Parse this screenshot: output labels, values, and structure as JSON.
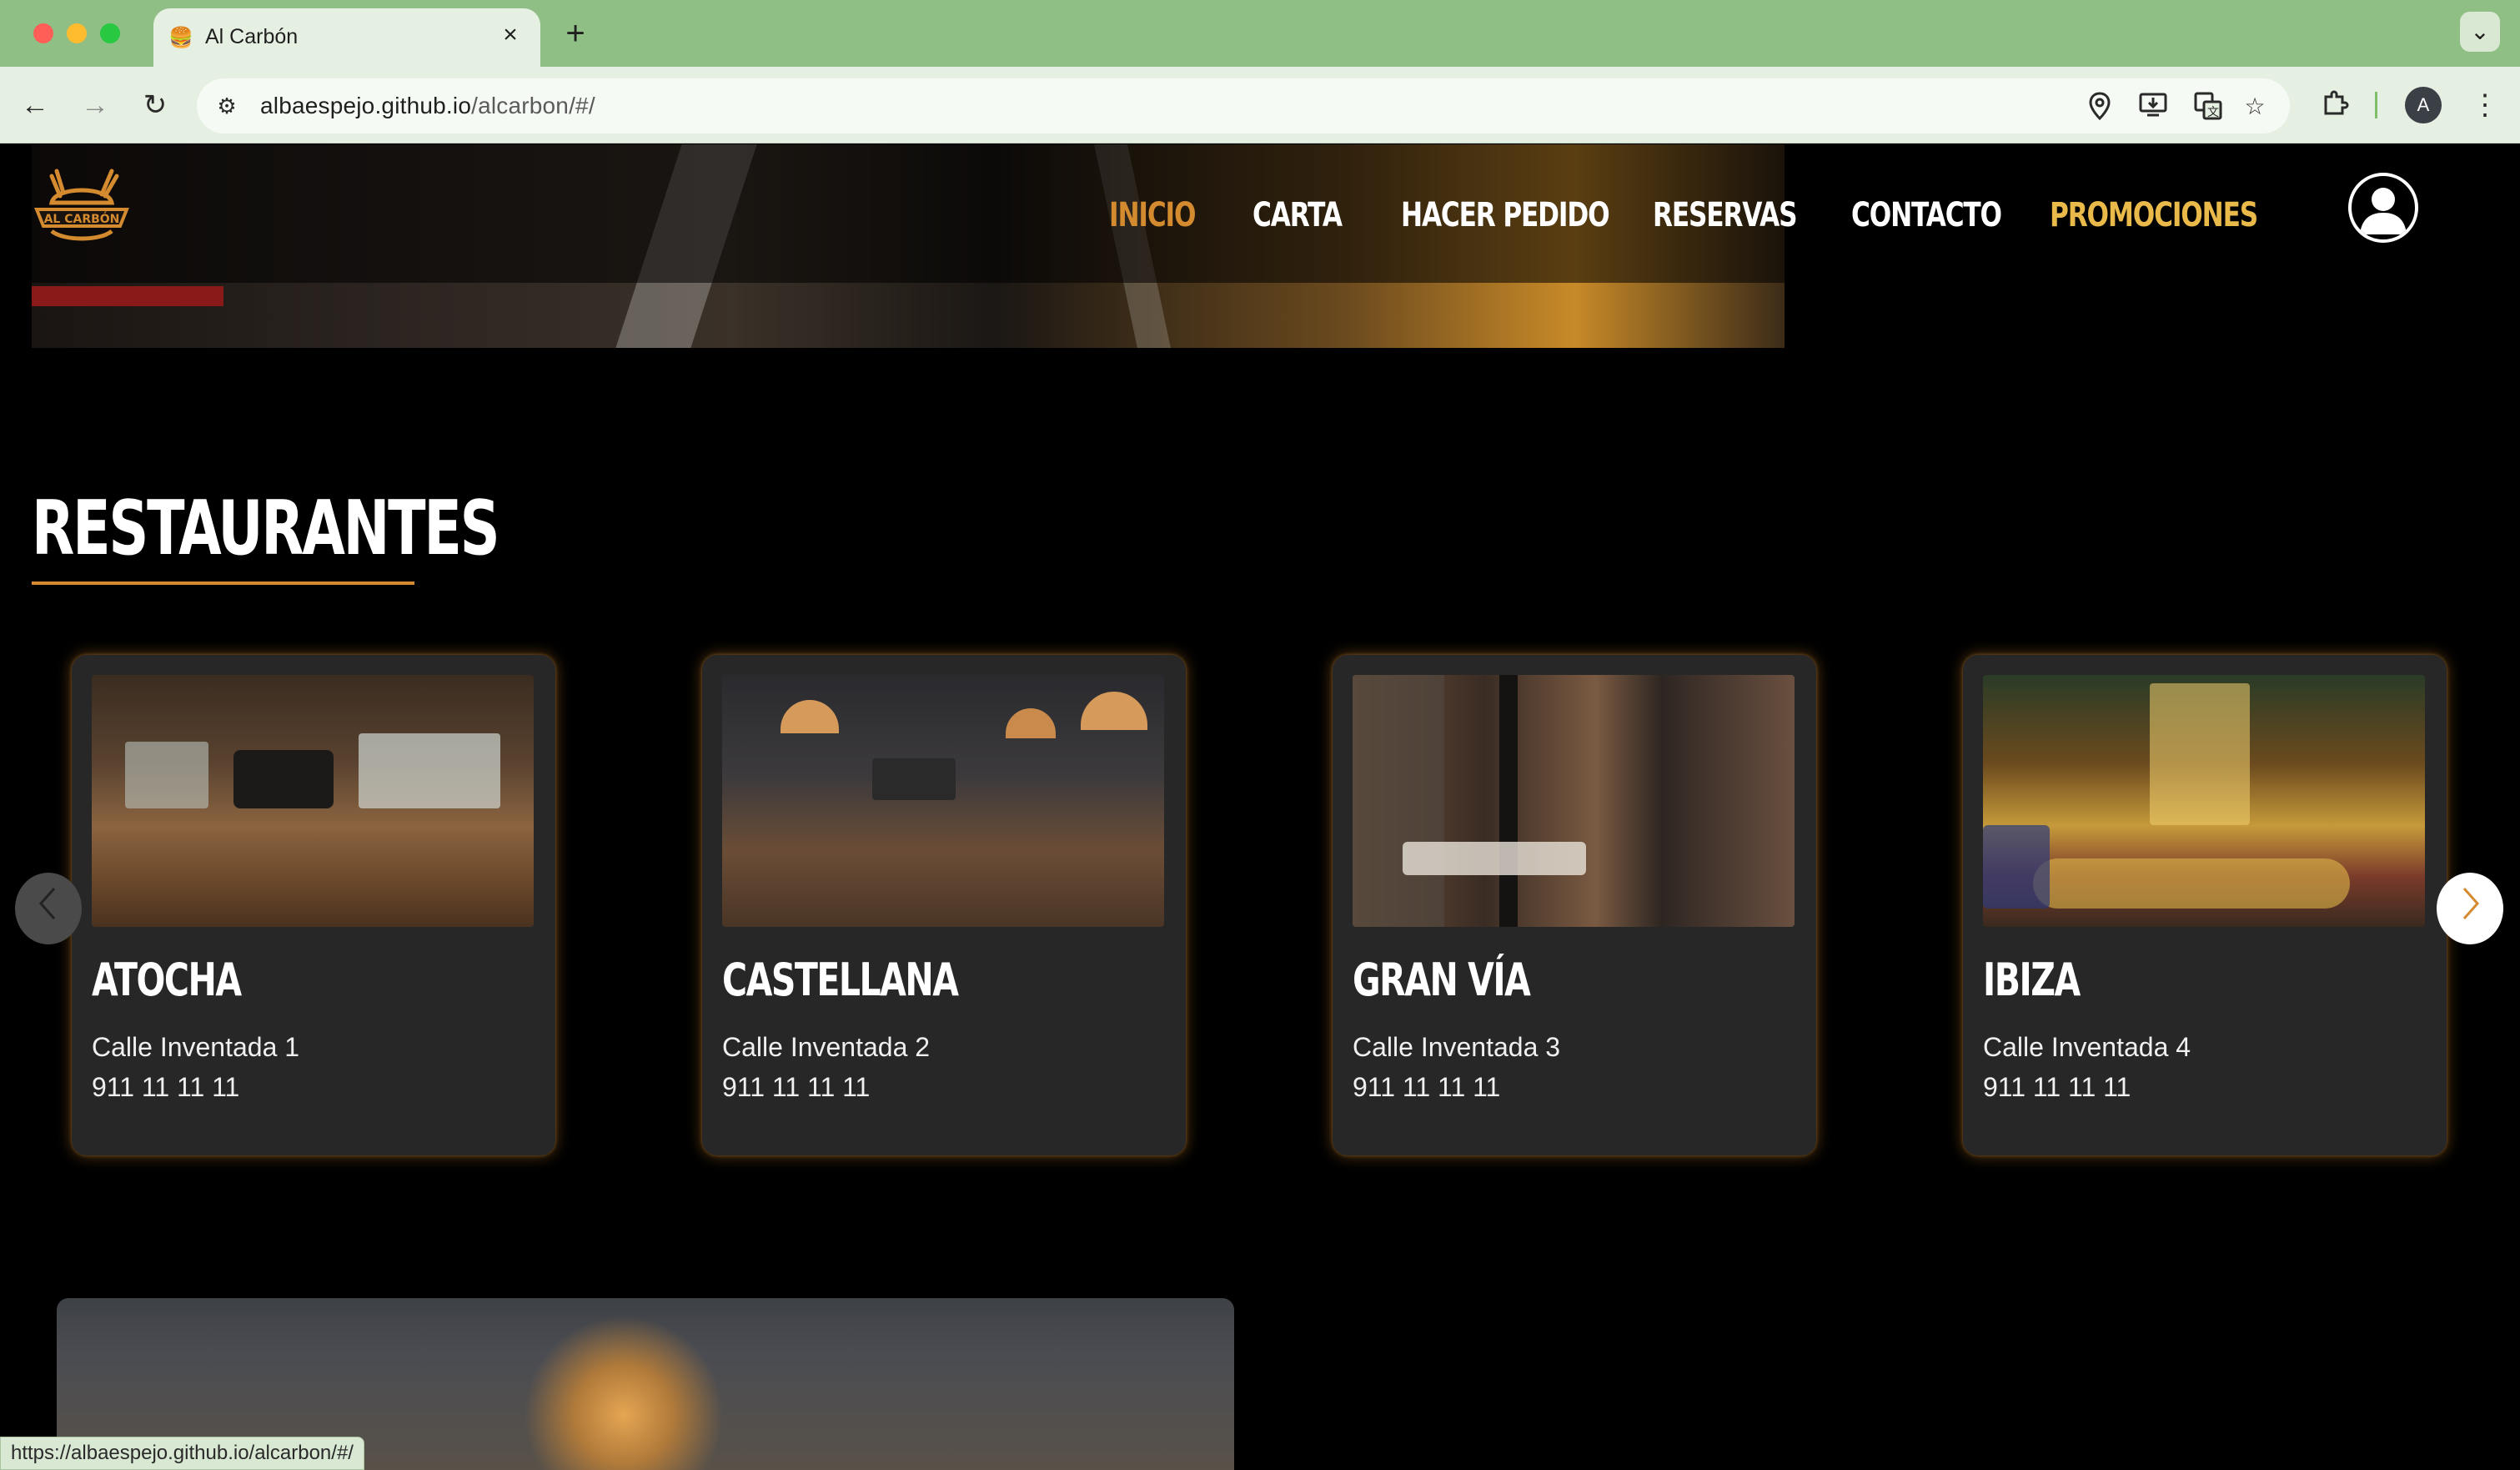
{
  "browser": {
    "tab_title": "Al Carbón",
    "new_tab": "+",
    "url_host": "albaespejo.github.io",
    "url_path": "/alcarbon/#/",
    "avatar_letter": "A",
    "status_url": "https://albaespejo.github.io/alcarbon/#/"
  },
  "header": {
    "logo_text": "AL CARBÓN",
    "nav": [
      {
        "label": "INICIO",
        "active": true
      },
      {
        "label": "CARTA"
      },
      {
        "label": "HACER PEDIDO"
      },
      {
        "label": "RESERVAS"
      },
      {
        "label": "CONTACTO"
      },
      {
        "label": "PROMOCIONES",
        "highlight": true
      }
    ]
  },
  "restaurants": {
    "title": "RESTAURANTES",
    "items": [
      {
        "name": "ATOCHA",
        "address": "Calle Inventada 1",
        "phone": "911 11 11 11"
      },
      {
        "name": "CASTELLANA",
        "address": "Calle Inventada 2",
        "phone": "911 11 11 11"
      },
      {
        "name": "GRAN VÍA",
        "address": "Calle Inventada 3",
        "phone": "911 11 11 11"
      },
      {
        "name": "IBIZA",
        "address": "Calle Inventada 4",
        "phone": "911 11 11 11"
      }
    ]
  },
  "colors": {
    "accent": "#d48a2e",
    "promo": "#e9b949",
    "card_bg": "#272727",
    "tabbar": "#8fbf85"
  },
  "icons": {
    "prev": "chevron-left-icon",
    "next": "chevron-right-icon",
    "user": "user-circle-icon"
  }
}
